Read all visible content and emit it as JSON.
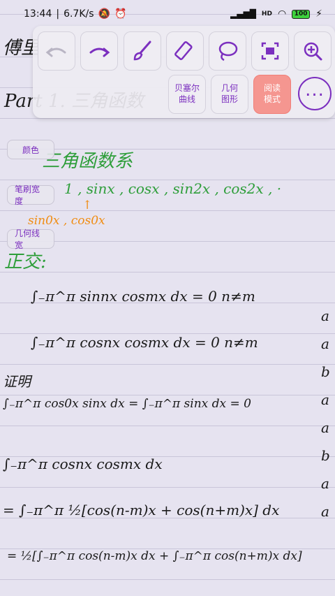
{
  "status_bar": {
    "time": "13:44",
    "network_speed": "6.7K/s",
    "signal": "HD",
    "battery": "100"
  },
  "toolbar": {
    "undo": "undo-icon",
    "redo": "redo-icon",
    "brush": "brush-icon",
    "eraser": "eraser-icon",
    "lasso": "lasso-icon",
    "screenshot": "screenshot-icon",
    "zoom": "zoom-in-icon",
    "bezier_label_1": "贝塞尔",
    "bezier_label_2": "曲线",
    "geometry_label_1": "几何",
    "geometry_label_2": "图形",
    "reading_label_1": "阅读",
    "reading_label_2": "模式",
    "more": "more-icon"
  },
  "side_options": {
    "color": "颜色",
    "brush_width": "笔刷宽度",
    "geometry_width": "几何线宽"
  },
  "notes": {
    "title_partial": "傅里",
    "part_heading": "Part 1. 三角函数",
    "section": "三角函数系",
    "series": "1 , sinx , cosx , sin2x , cos2x , ·",
    "annotation": "sin0x , cos0x",
    "orthogonal": "正交:",
    "eq1": "∫₋π^π sinnx cosmx dx = 0     n≠m",
    "eq2": "∫₋π^π cosnx cosmx dx = 0     n≠m",
    "proof": "证明",
    "eq3": "∫₋π^π cos0x sinx dx = ∫₋π^π sinx dx = 0",
    "eq4": "∫₋π^π cosnx cosmx dx",
    "eq5": "= ∫₋π^π ½[cos(n-m)x + cos(n+m)x] dx",
    "eq6": "= ½[∫₋π^π cos(n-m)x dx + ∫₋π^π cos(n+m)x dx]",
    "right_margin": [
      "a",
      "a",
      "b",
      "a",
      "a",
      "b",
      "a",
      "a"
    ]
  },
  "colors": {
    "accent": "#7b2fbf",
    "reading_mode": "#f59690",
    "green_ink": "#2e9e3a",
    "orange_ink": "#f08d14"
  }
}
